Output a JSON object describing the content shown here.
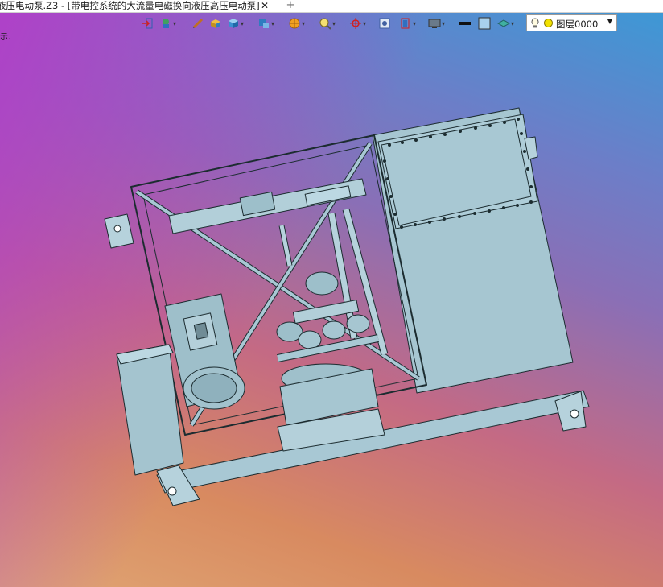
{
  "document_tab": {
    "title": "液压电动泵.Z3 - [带电控系统的大流量电磁换向液压高压电动泵]",
    "close_glyph": "✕",
    "new_tab_glyph": "+"
  },
  "side_hint": "示.",
  "toolbar": {
    "icons": [
      "exit-icon",
      "curve-icon",
      "sketch-icon",
      "solid-icon",
      "box-icon",
      "shape-icon",
      "render-icon",
      "view-icon",
      "snap-icon",
      "display-icon",
      "screen-icon",
      "line-style-icon",
      "color-icon",
      "layer-icon"
    ],
    "layer": {
      "value": "图层0000",
      "bulb": "bulb-icon"
    }
  },
  "colors": {
    "model_fill": "#a8c8d4",
    "model_edge": "#1c2c30",
    "bg_top_right": "#3a9ad6",
    "bg_top_left": "#b040c8",
    "bg_bottom": "#e0a674"
  }
}
